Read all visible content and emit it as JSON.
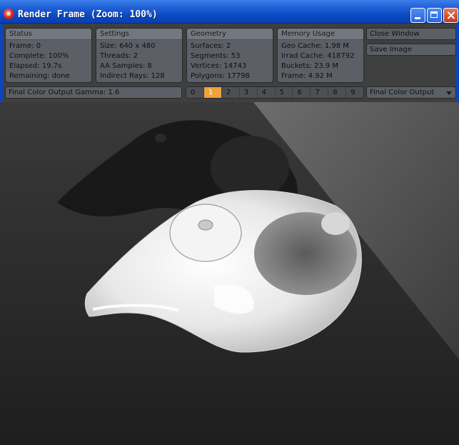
{
  "window": {
    "title": "Render Frame (Zoom: 100%)"
  },
  "groups": {
    "status": {
      "header": "Status",
      "rows": [
        "Frame: 0",
        "Complete: 100%",
        "Elapsed: 19.7s",
        "Remaining: done"
      ]
    },
    "settings": {
      "header": "Settings",
      "rows": [
        "Size: 640 x 480",
        "Threads: 2",
        "AA Samples: 8",
        "Indirect Rays: 128"
      ]
    },
    "geometry": {
      "header": "Geometry",
      "rows": [
        "Surfaces: 2",
        "Segments: 53",
        "Vertices: 14743",
        "Polygons: 17798"
      ]
    },
    "memory": {
      "header": "Memory Usage",
      "rows": [
        "Geo Cache: 1.98 M",
        "Irrad Cache: 418792",
        "Buckets: 23.9 M",
        "Frame: 4.92 M"
      ]
    }
  },
  "buttons": {
    "close_window": "Close Window",
    "save_image": "Save Image"
  },
  "gamma_label": "Final Color Output Gamma: 1.6",
  "pages": [
    "0",
    "1",
    "2",
    "3",
    "4",
    "5",
    "6",
    "7",
    "8",
    "9"
  ],
  "active_page": "1",
  "output_select": "Final Color Output",
  "colors": {
    "accent": "#f0a23c",
    "titlebar": "#0a47c2",
    "panel": "#3f3f3f",
    "group": "#5c6066"
  }
}
